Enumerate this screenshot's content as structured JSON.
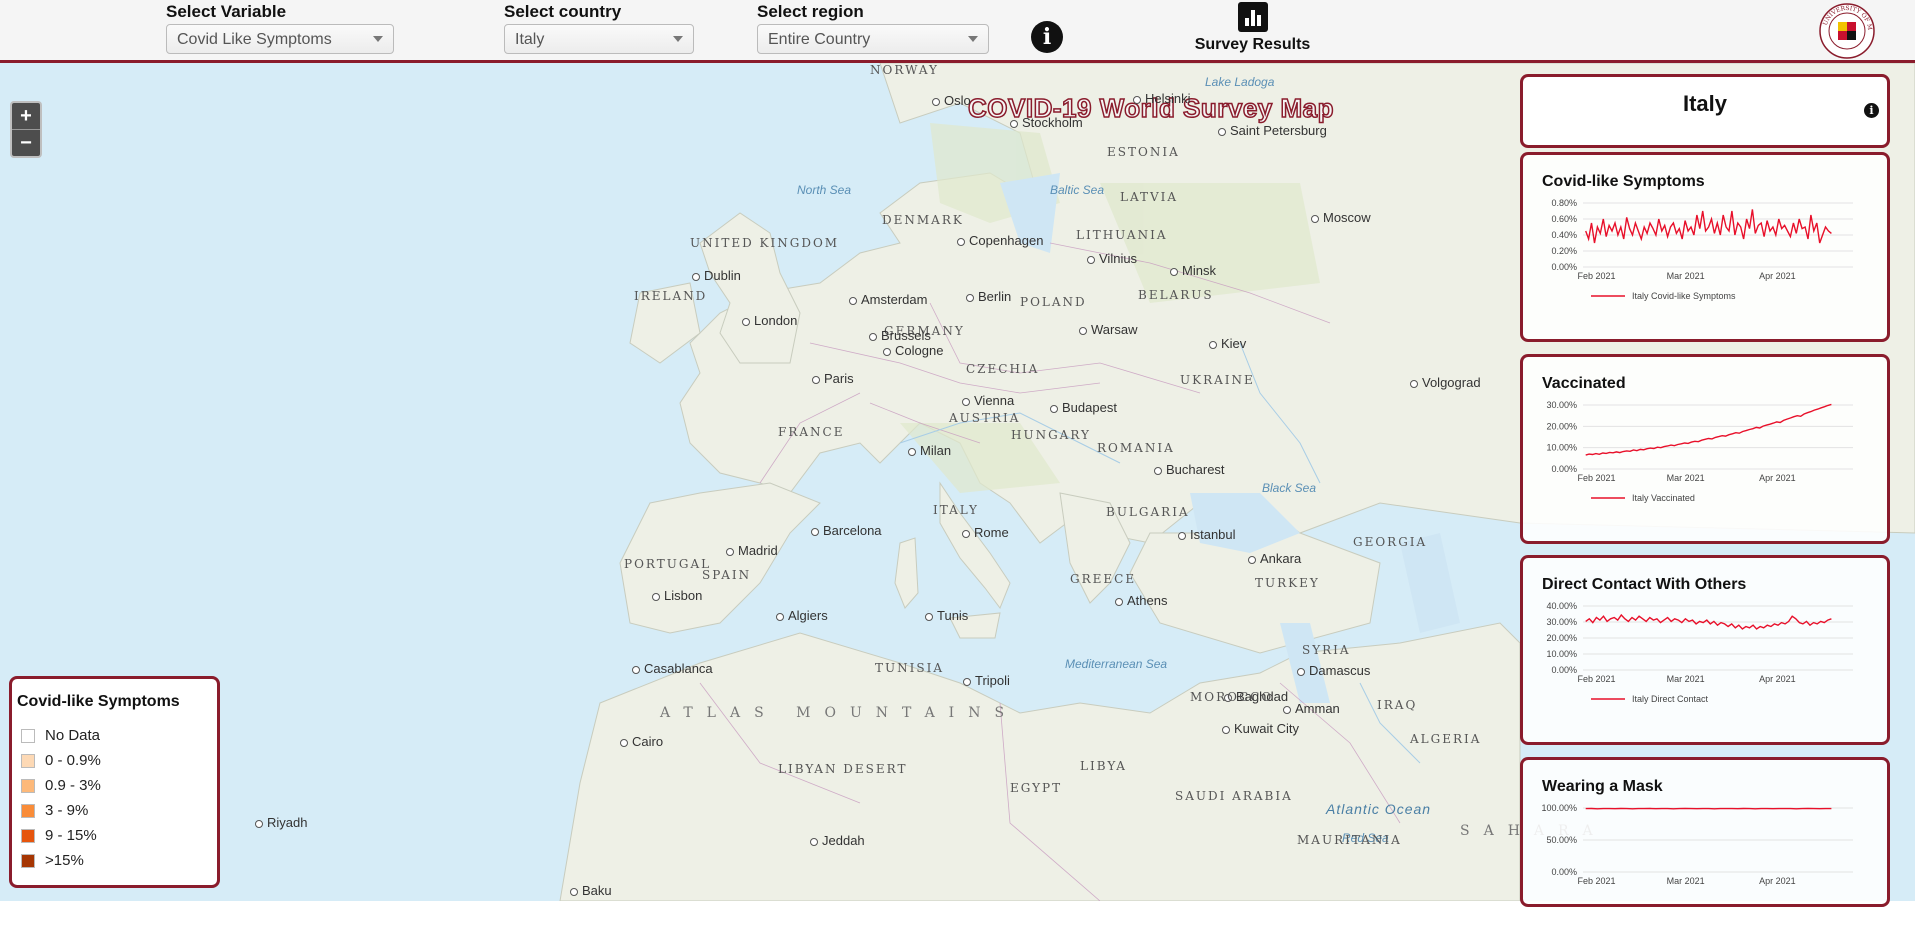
{
  "topbar": {
    "variable": {
      "label": "Select Variable",
      "value": "Covid Like Symptoms"
    },
    "country": {
      "label": "Select country",
      "value": "Italy"
    },
    "region": {
      "label": "Select region",
      "value": "Entire Country"
    },
    "survey_results_label": "Survey Results",
    "logo_text": "UNIVERSITY OF MARYLAND"
  },
  "map": {
    "title": "COVID-19 World Survey Map",
    "zoom_in": "+",
    "zoom_out": "−",
    "places": [
      {
        "text": "NORWAY",
        "type": "country"
      },
      {
        "text": "Oslo",
        "type": "city"
      },
      {
        "text": "Helsinki",
        "type": "city"
      },
      {
        "text": "Lake Ladoga",
        "type": "sea"
      },
      {
        "text": "Stockholm",
        "type": "city"
      },
      {
        "text": "Saint Petersburg",
        "type": "city"
      },
      {
        "text": "ESTONIA",
        "type": "country"
      },
      {
        "text": "North Sea",
        "type": "sea"
      },
      {
        "text": "Baltic Sea",
        "type": "sea"
      },
      {
        "text": "LATVIA",
        "type": "country"
      },
      {
        "text": "DENMARK",
        "type": "country"
      },
      {
        "text": "Moscow",
        "type": "city"
      },
      {
        "text": "UNITED KINGDOM",
        "type": "country"
      },
      {
        "text": "Copenhagen",
        "type": "city"
      },
      {
        "text": "LITHUANIA",
        "type": "country"
      },
      {
        "text": "Vilnius",
        "type": "city"
      },
      {
        "text": "Minsk",
        "type": "city"
      },
      {
        "text": "Dublin",
        "type": "city"
      },
      {
        "text": "IRELAND",
        "type": "country"
      },
      {
        "text": "Amsterdam",
        "type": "city"
      },
      {
        "text": "Berlin",
        "type": "city"
      },
      {
        "text": "POLAND",
        "type": "country"
      },
      {
        "text": "BELARUS",
        "type": "country"
      },
      {
        "text": "London",
        "type": "city"
      },
      {
        "text": "GERMANY",
        "type": "country"
      },
      {
        "text": "Brussels",
        "type": "city"
      },
      {
        "text": "Warsaw",
        "type": "city"
      },
      {
        "text": "Cologne",
        "type": "city"
      },
      {
        "text": "Kiev",
        "type": "city"
      },
      {
        "text": "CZECHIA",
        "type": "country"
      },
      {
        "text": "Paris",
        "type": "city"
      },
      {
        "text": "UKRAINE",
        "type": "country"
      },
      {
        "text": "Volgograd",
        "type": "city"
      },
      {
        "text": "Vienna",
        "type": "city"
      },
      {
        "text": "AUSTRIA",
        "type": "country"
      },
      {
        "text": "Budapest",
        "type": "city"
      },
      {
        "text": "FRANCE",
        "type": "country"
      },
      {
        "text": "HUNGARY",
        "type": "country"
      },
      {
        "text": "ROMANIA",
        "type": "country"
      },
      {
        "text": "Milan",
        "type": "city"
      },
      {
        "text": "Bucharest",
        "type": "city"
      },
      {
        "text": "ITALY",
        "type": "country"
      },
      {
        "text": "Black Sea",
        "type": "sea"
      },
      {
        "text": "BULGARIA",
        "type": "country"
      },
      {
        "text": "Rome",
        "type": "city"
      },
      {
        "text": "Barcelona",
        "type": "city"
      },
      {
        "text": "GEORGIA",
        "type": "country"
      },
      {
        "text": "Istanbul",
        "type": "city"
      },
      {
        "text": "Madrid",
        "type": "city"
      },
      {
        "text": "PORTUGAL",
        "type": "country"
      },
      {
        "text": "SPAIN",
        "type": "country"
      },
      {
        "text": "Ankara",
        "type": "city"
      },
      {
        "text": "GREECE",
        "type": "country"
      },
      {
        "text": "Lisbon",
        "type": "city"
      },
      {
        "text": "TURKEY",
        "type": "country"
      },
      {
        "text": "Athens",
        "type": "city"
      },
      {
        "text": "Algiers",
        "type": "city"
      },
      {
        "text": "Tunis",
        "type": "city"
      },
      {
        "text": "ATLAS MOUNTAINS",
        "type": "region"
      },
      {
        "text": "TUNISIA",
        "type": "country"
      },
      {
        "text": "SYRIA",
        "type": "country"
      },
      {
        "text": "Casablanca",
        "type": "city"
      },
      {
        "text": "Mediterranean Sea",
        "type": "sea"
      },
      {
        "text": "Damascus",
        "type": "city"
      },
      {
        "text": "Tripoli",
        "type": "city"
      },
      {
        "text": "IRAQ",
        "type": "country"
      },
      {
        "text": "Baghdad",
        "type": "city"
      },
      {
        "text": "Amman",
        "type": "city"
      },
      {
        "text": "MOROCCO",
        "type": "country"
      },
      {
        "text": "Cairo",
        "type": "city"
      },
      {
        "text": "Kuwait City",
        "type": "city"
      },
      {
        "text": "ALGERIA",
        "type": "country"
      },
      {
        "text": "LIBYAN DESERT",
        "type": "country"
      },
      {
        "text": "LIBYA",
        "type": "country"
      },
      {
        "text": "EGYPT",
        "type": "country"
      },
      {
        "text": "SAUDI ARABIA",
        "type": "country"
      },
      {
        "text": "Atlantic Ocean",
        "type": "ocean"
      },
      {
        "text": "Riyadh",
        "type": "city"
      },
      {
        "text": "SAHARA",
        "type": "region"
      },
      {
        "text": "Jeddah",
        "type": "city"
      },
      {
        "text": "Red Sea",
        "type": "sea"
      },
      {
        "text": "MAURITANIA",
        "type": "country"
      },
      {
        "text": "Baku",
        "type": "city"
      }
    ]
  },
  "legend": {
    "title": "Covid-like Symptoms",
    "items": [
      {
        "label": "No Data",
        "color": "#ffffff"
      },
      {
        "label": "0 - 0.9%",
        "color": "#fdd9b5"
      },
      {
        "label": "0.9 - 3%",
        "color": "#fdb97a"
      },
      {
        "label": "3 - 9%",
        "color": "#f98c38"
      },
      {
        "label": "9 - 15%",
        "color": "#e6550d"
      },
      {
        "label": ">15%",
        "color": "#a63603"
      }
    ]
  },
  "side_panel": {
    "country_name": "Italy"
  },
  "colors": {
    "accent": "#8a1c2c",
    "series": "#e8102a"
  },
  "chart_data": [
    {
      "type": "line",
      "title": "Covid-like Symptoms",
      "x_ticks": [
        "Feb 2021",
        "Mar 2021",
        "Apr 2021"
      ],
      "y_ticks": [
        "0.00%",
        "0.20%",
        "0.40%",
        "0.60%",
        "0.80%"
      ],
      "ylim": [
        0,
        0.8
      ],
      "series": [
        {
          "name": "Italy Covid-like Symptoms",
          "values": [
            0.45,
            0.35,
            0.55,
            0.3,
            0.5,
            0.42,
            0.6,
            0.38,
            0.52,
            0.45,
            0.55,
            0.4,
            0.5,
            0.35,
            0.62,
            0.48,
            0.4,
            0.55,
            0.45,
            0.35,
            0.5,
            0.42,
            0.55,
            0.48,
            0.4,
            0.6,
            0.45,
            0.52,
            0.38,
            0.5,
            0.55,
            0.42,
            0.48,
            0.35,
            0.58,
            0.45,
            0.5,
            0.4,
            0.65,
            0.48,
            0.7,
            0.45,
            0.5,
            0.6,
            0.42,
            0.55,
            0.4,
            0.65,
            0.5,
            0.45,
            0.7,
            0.4,
            0.55,
            0.5,
            0.35,
            0.6,
            0.48,
            0.72,
            0.42,
            0.52,
            0.55,
            0.38,
            0.58,
            0.45,
            0.5,
            0.4,
            0.6,
            0.48,
            0.52,
            0.45,
            0.38,
            0.55,
            0.42,
            0.6,
            0.48,
            0.5,
            0.35,
            0.65,
            0.45,
            0.55,
            0.3,
            0.4,
            0.5,
            0.45,
            0.42
          ]
        }
      ]
    },
    {
      "type": "line",
      "title": "Vaccinated",
      "x_ticks": [
        "Feb 2021",
        "Mar 2021",
        "Apr 2021"
      ],
      "y_ticks": [
        "0.00%",
        "10.00%",
        "20.00%",
        "30.00%"
      ],
      "ylim": [
        0,
        30
      ],
      "series": [
        {
          "name": "Italy Vaccinated",
          "values": [
            6.5,
            7,
            6.8,
            7.2,
            6.9,
            7.5,
            7.3,
            7.8,
            7.6,
            8,
            7.7,
            8.2,
            8.5,
            8.3,
            8.9,
            8.6,
            9.2,
            9,
            9.5,
            9.8,
            9.6,
            10.2,
            10,
            10.5,
            10.8,
            11.2,
            10.9,
            11.5,
            11.8,
            12.2,
            12,
            12.6,
            13,
            12.8,
            13.5,
            13.9,
            14.3,
            14.1,
            14.8,
            15.2,
            15.6,
            15.4,
            16.1,
            16.5,
            17,
            16.8,
            17.6,
            18,
            18.5,
            18.9,
            19.5,
            19.2,
            20.1,
            20.6,
            21,
            21.5,
            22.1,
            21.8,
            22.8,
            23.4,
            23.9,
            24.5,
            25,
            24.7,
            25.8,
            26.4,
            26.9,
            27.6,
            28.1,
            28.7,
            29.2,
            29.8,
            30.3
          ]
        }
      ]
    },
    {
      "type": "line",
      "title": "Direct Contact With Others",
      "x_ticks": [
        "Feb 2021",
        "Mar 2021",
        "Apr 2021"
      ],
      "y_ticks": [
        "0.00%",
        "10.00%",
        "20.00%",
        "30.00%",
        "40.00%"
      ],
      "ylim": [
        0,
        50
      ],
      "series": [
        {
          "name": "Italy Direct Contact",
          "values": [
            38,
            40,
            37,
            41,
            39,
            42,
            38,
            40,
            41,
            39,
            43,
            40,
            38,
            41,
            39,
            42,
            40,
            38,
            41,
            39,
            40,
            37,
            39,
            41,
            38,
            40,
            39,
            37,
            40,
            38,
            39,
            36,
            38,
            37,
            39,
            36,
            38,
            35,
            37,
            36,
            34,
            36,
            33,
            35,
            32,
            34,
            33,
            35,
            32,
            34,
            33,
            35,
            34,
            36,
            35,
            37,
            36,
            38,
            42,
            40,
            37,
            36,
            38,
            35,
            37,
            36,
            38,
            37,
            39,
            40
          ]
        }
      ]
    },
    {
      "type": "line",
      "title": "Wearing a Mask",
      "x_ticks": [
        "Feb 2021",
        "Mar 2021",
        "Apr 2021"
      ],
      "y_ticks": [
        "0.00%",
        "50.00%",
        "100.00%"
      ],
      "ylim": [
        0,
        100
      ],
      "series": [
        {
          "name": "Italy Wearing a Mask",
          "values": [
            99,
            99.2,
            98.8,
            99.1,
            99,
            98.9,
            99.2,
            99,
            98.8,
            99.1,
            99,
            99.2,
            98.9,
            99,
            99.1,
            98.8,
            99,
            99.2,
            99,
            98.9,
            99.1,
            99,
            98.8,
            99,
            99.1,
            99,
            98.9,
            99.2,
            99,
            98.8,
            99.1,
            99,
            98.9,
            99,
            99.1,
            99,
            98.8,
            99,
            99.2,
            99,
            98.9,
            99.1,
            99
          ]
        }
      ]
    }
  ]
}
